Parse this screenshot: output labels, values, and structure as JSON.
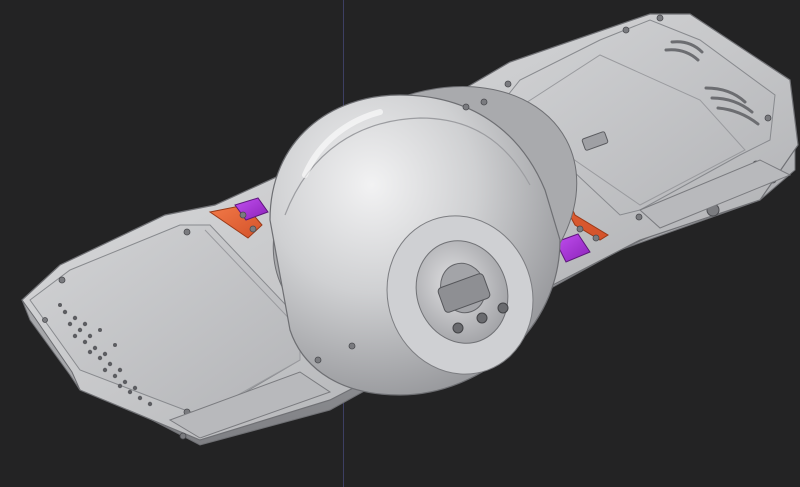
{
  "viewport": {
    "background": "#232324",
    "guide_line_color": "#3d3f63"
  },
  "model": {
    "body_color": "#c9c9cb",
    "panel_color": "#c1c2c5",
    "shadow_color": "#8f9094",
    "wheel_color": "#d4d4d6",
    "hub_color": "#b9babd",
    "frame_accent": "#ef6a3a",
    "bracket_accent": "#a532d3"
  }
}
